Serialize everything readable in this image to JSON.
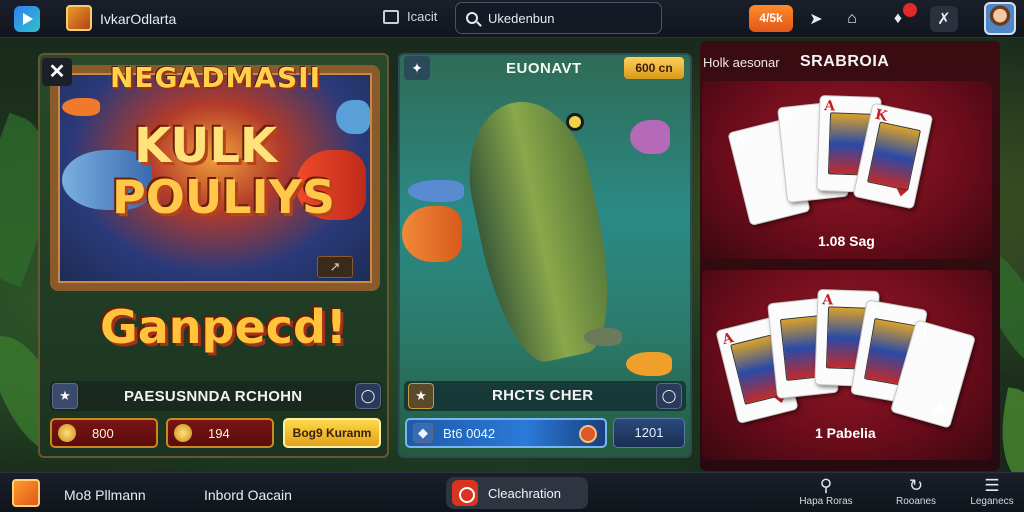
{
  "topbar": {
    "app_title": "IvkarOdlarta",
    "nav_link": "Icacit",
    "search_text": "Ukedenbun",
    "coin_label": "4/5k"
  },
  "panel_fishing_left": {
    "brand": "NEGADMASII",
    "title_line1": "KULK",
    "title_line2": "POULIYS",
    "promo_text": "Ganpecd!",
    "info_label": "PAESUSNNDA RCHOHN",
    "stat1": "800",
    "stat2": "194",
    "action_label": "Bog9 Kuranm"
  },
  "panel_fishing_right": {
    "title": "EUONAVT",
    "badge": "600 cn",
    "info_label": "RHCTS CHER",
    "stat1": "Bt6 0042",
    "stat2": "1201"
  },
  "panel_cards": {
    "label": "Holk aesonar",
    "title": "SRABROIA",
    "caption1": "1.08 Sag",
    "caption2": "1 Pabelia"
  },
  "bottombar": {
    "item1": "Mo8 Pllmann",
    "item2": "Inbord Oacain",
    "center_label": "Cleachration",
    "right1_label": "Hapa Roras",
    "right2_label": "Rooanes",
    "right3_label": "Leganecs"
  },
  "colors": {
    "accent_orange": "#e2571a",
    "gold": "#ffc43a",
    "card_red": "#6a0c1a",
    "notif_red": "#e22a2a"
  }
}
